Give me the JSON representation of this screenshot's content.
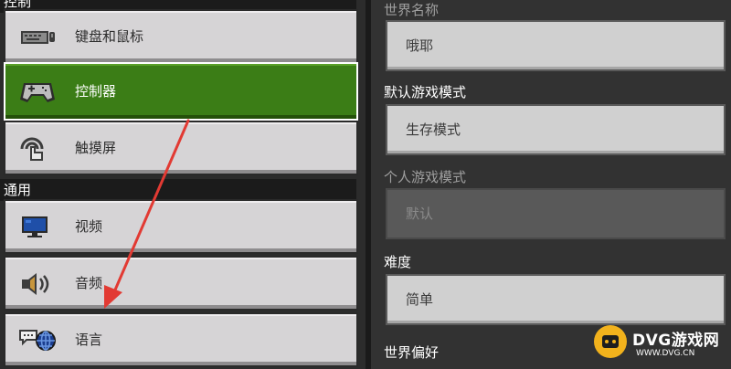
{
  "sidebar": {
    "section_controls": "控制",
    "section_general": "通用",
    "items": [
      {
        "label": "键盘和鼠标",
        "icon": "keyboard-icon",
        "active": false
      },
      {
        "label": "控制器",
        "icon": "gamepad-icon",
        "active": true
      },
      {
        "label": "触摸屏",
        "icon": "touch-icon",
        "active": false
      },
      {
        "label": "视频",
        "icon": "monitor-icon",
        "active": false
      },
      {
        "label": "音频",
        "icon": "speaker-icon",
        "active": false
      },
      {
        "label": "语言",
        "icon": "globe-speech-icon",
        "active": false
      }
    ]
  },
  "settings": {
    "world_name_label": "世界名称",
    "world_name_value": "哦耶",
    "default_mode_label": "默认游戏模式",
    "default_mode_value": "生存模式",
    "personal_mode_label": "个人游戏模式",
    "personal_mode_value": "默认",
    "difficulty_label": "难度",
    "difficulty_value": "简单",
    "world_prefs_label": "世界偏好"
  },
  "watermark": {
    "brand": "DVG游戏网",
    "url": "WWW.DVG.CN"
  },
  "colors": {
    "active_green": "#3b7d16",
    "annotation_red": "#e23a33",
    "watermark_yellow": "#f2b21c"
  }
}
